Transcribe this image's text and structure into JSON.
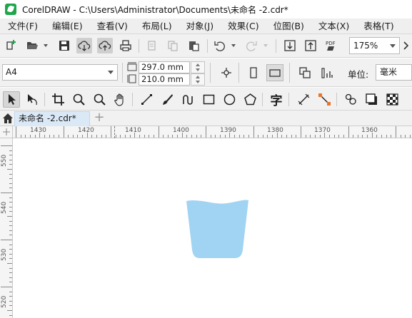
{
  "window": {
    "title": "CorelDRAW - C:\\Users\\Administrator\\Documents\\未命名 -2.cdr*"
  },
  "menu": [
    "文件(F)",
    "编辑(E)",
    "查看(V)",
    "布局(L)",
    "对象(J)",
    "效果(C)",
    "位图(B)",
    "文本(X)",
    "表格(T)"
  ],
  "standard_toolbar": {
    "zoom_level": "175%",
    "icons": [
      "new-document-icon",
      "open-folder-icon",
      "save-icon",
      "cloud-download-icon",
      "cloud-upload-icon",
      "print-icon",
      "cut-icon",
      "copy-icon",
      "paste-icon",
      "undo-icon",
      "redo-icon",
      "import-icon",
      "export-icon",
      "publish-pdf-icon"
    ],
    "pdf_label": "PDF"
  },
  "property_bar": {
    "page_size": "A4",
    "width": "297.0 mm",
    "height": "210.0 mm",
    "units_label": "单位:",
    "units_value": "毫米"
  },
  "toolbox": {
    "icons": [
      "pick-tool-icon",
      "shape-tool-icon",
      "crop-tool-icon",
      "zoom-tool-icon",
      "zoom-out-icon",
      "pan-tool-icon",
      "freehand-tool-icon",
      "artistic-media-icon",
      "smart-drawing-icon",
      "rectangle-tool-icon",
      "ellipse-tool-icon",
      "polygon-tool-icon",
      "text-tool-icon",
      "parallel-dimension-icon",
      "connector-tool-icon",
      "blend-tool-icon",
      "drop-shadow-icon",
      "transparency-tool-icon"
    ],
    "text_tool_glyph": "字"
  },
  "tabs": {
    "document_tab": "未命名 -2.cdr*",
    "add_tab": "+"
  },
  "rulers": {
    "horizontal_labels": [
      "1430",
      "1420",
      "1410",
      "1400",
      "1390",
      "1380",
      "1370",
      "1360"
    ],
    "vertical_labels": [
      "550",
      "540",
      "530",
      "520"
    ]
  },
  "canvas": {
    "shape": "cup-shape",
    "shape_color": "#a0d4f2",
    "background": "#ffffff"
  },
  "colors": {
    "accent_tab": "#dbe9f7",
    "brand_green": "#1fa64a",
    "export_orange": "#e8752a"
  }
}
